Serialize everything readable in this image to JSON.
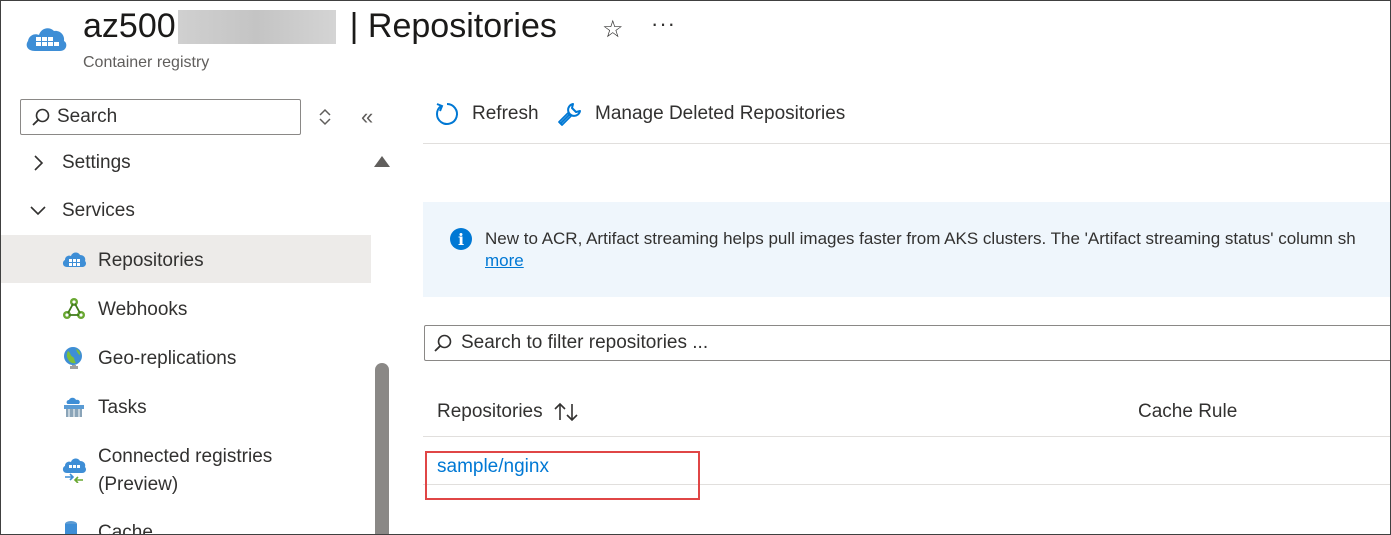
{
  "header": {
    "title_prefix": "az500",
    "title_suffix": "| Repositories",
    "subtitle": "Container registry"
  },
  "sidebar": {
    "search_placeholder": "Search",
    "groups": [
      {
        "label": "Settings",
        "expanded": false
      },
      {
        "label": "Services",
        "expanded": true
      }
    ],
    "items": [
      {
        "label": "Repositories",
        "active": true
      },
      {
        "label": "Webhooks",
        "active": false
      },
      {
        "label": "Geo-replications",
        "active": false
      },
      {
        "label": "Tasks",
        "active": false
      },
      {
        "label": "Connected registries",
        "label2": "(Preview)",
        "active": false
      },
      {
        "label": "Cache",
        "active": false
      }
    ]
  },
  "toolbar": {
    "refresh_label": "Refresh",
    "manage_deleted_label": "Manage Deleted Repositories"
  },
  "info": {
    "text": "New to ACR, Artifact streaming helps pull images faster from AKS clusters. The 'Artifact streaming status' column sh",
    "more_link": "more"
  },
  "filter": {
    "placeholder": "Search to filter repositories ..."
  },
  "table": {
    "columns": [
      "Repositories",
      "Cache Rule"
    ],
    "rows": [
      {
        "repository": "sample/nginx",
        "cache_rule": ""
      }
    ]
  },
  "colors": {
    "accent": "#0078d4",
    "highlight": "#e04646",
    "info_bg": "#eff6fc",
    "active_bg": "#edebe9"
  }
}
